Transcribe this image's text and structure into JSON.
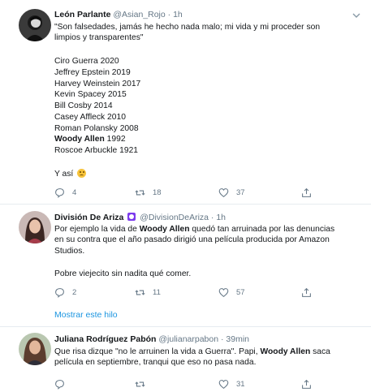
{
  "tweets": [
    {
      "name": "León Parlante",
      "handle": "@Asian_Rojo",
      "time": "1h",
      "lines": [
        "\"Son falsedades, jamás he hecho nada malo; mi vida y mi proceder son",
        "limpios y transparentes\"",
        "",
        "Ciro Guerra 2020",
        "Jeffrey Epstein 2019",
        "Harvey Weinstein 2017",
        "Kevin Spacey 2015",
        "Bill Cosby 2014",
        "Casey Affleck 2010",
        "Roman Polansky 2008",
        "",
        "Roscoe Arbuckle 1921",
        "",
        "",
        "Y así"
      ],
      "bold_line": {
        "name": "Woody Allen",
        "year": "1992"
      },
      "replies": "4",
      "retweets": "18",
      "likes": "37"
    },
    {
      "name": "División De Ariza",
      "handle": "@DivisionDeAriza",
      "time": "1h",
      "lines": [
        "Por ejemplo la vida de",
        "Woody Allen",
        "quedó tan arruinada por las denuncias",
        "en su contra que el año pasado dirigió una película producida por Amazon",
        "Studios.",
        "Pobre viejecito sin nadita qué comer."
      ],
      "replies": "2",
      "retweets": "11",
      "likes": "57",
      "show_thread": "Mostrar este hilo"
    },
    {
      "name": "Juliana Rodríguez Pabón",
      "handle": "@julianarpabon",
      "time": "39min",
      "lines": [
        "Que risa dizque \"no le arruinen la vida a Guerra\". Papi,",
        "Woody Allen",
        "saca",
        "película en septiembre, tranqui que eso no pasa nada."
      ],
      "replies": "",
      "retweets": "",
      "likes": "31"
    }
  ],
  "icons": {
    "reply": "reply-icon",
    "retweet": "retweet-icon",
    "like": "heart-icon",
    "share": "share-icon",
    "caret": "chevron-down-icon"
  },
  "colors": {
    "text": "#14171a",
    "secondary": "#657786",
    "link": "#1b95e0",
    "divider": "#e6ecf0"
  }
}
